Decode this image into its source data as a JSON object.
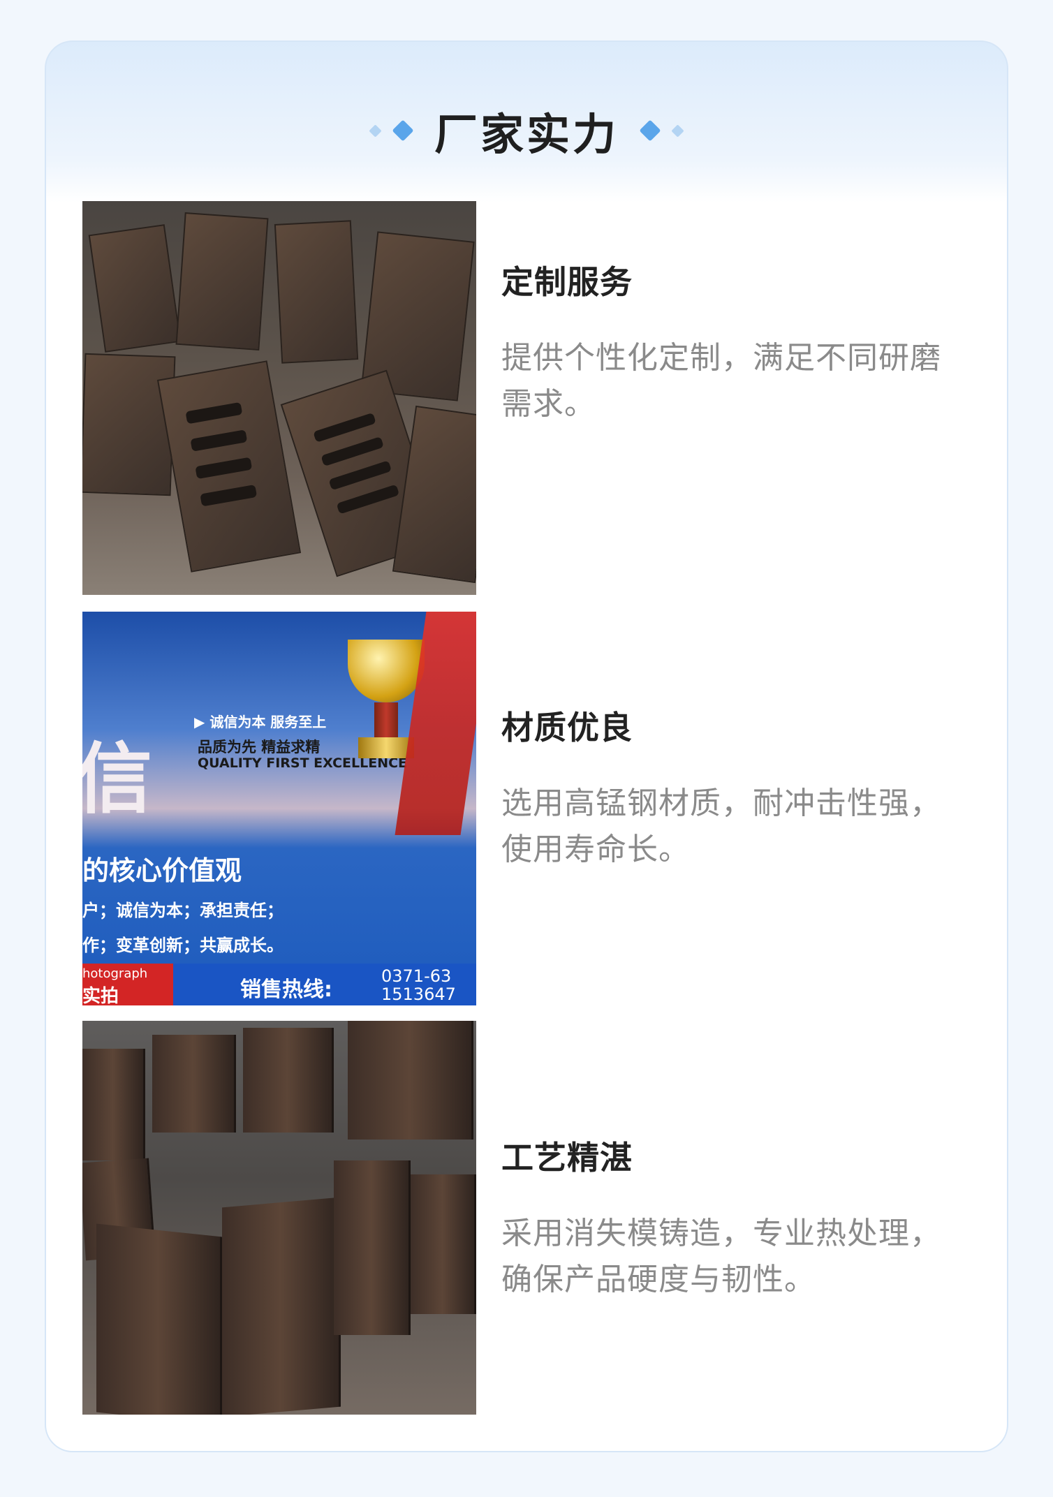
{
  "section": {
    "title": "厂家实力"
  },
  "features": [
    {
      "title": "定制服务",
      "desc_line1": "提供个性化定制，满足不同研磨",
      "desc_line2": "需求。",
      "image": "wear-liner-plates-photo"
    },
    {
      "title": "材质优良",
      "desc_line1": "选用高锰钢材质，耐冲击性强，",
      "desc_line2": "使用寿命长。",
      "image": "company-banner-photo",
      "banner": {
        "big_char": "信",
        "slogan1": "▶ 诚信为本 服务至上",
        "slogan2": "品质为先 精益求精",
        "slogan3": "QUALITY FIRST EXCELLENCE",
        "values_title": "的核心价值观",
        "values_line1": "户；诚信为本；承担责任；",
        "values_line2": "作；变革创新；共赢成长。",
        "photo_tag1": "hotograph",
        "photo_tag2": "实拍",
        "hotline_label": "销售热线:",
        "hotline_num1": "0371-63",
        "hotline_num2": "1513647"
      }
    },
    {
      "title": "工艺精湛",
      "desc_line1": "采用消失模铸造，专业热处理，",
      "desc_line2": "确保产品硬度与韧性。",
      "image": "stacked-castings-photo"
    }
  ],
  "colors": {
    "accent": "#5aa5ea",
    "title": "#222222",
    "desc": "#8a8a8a"
  }
}
